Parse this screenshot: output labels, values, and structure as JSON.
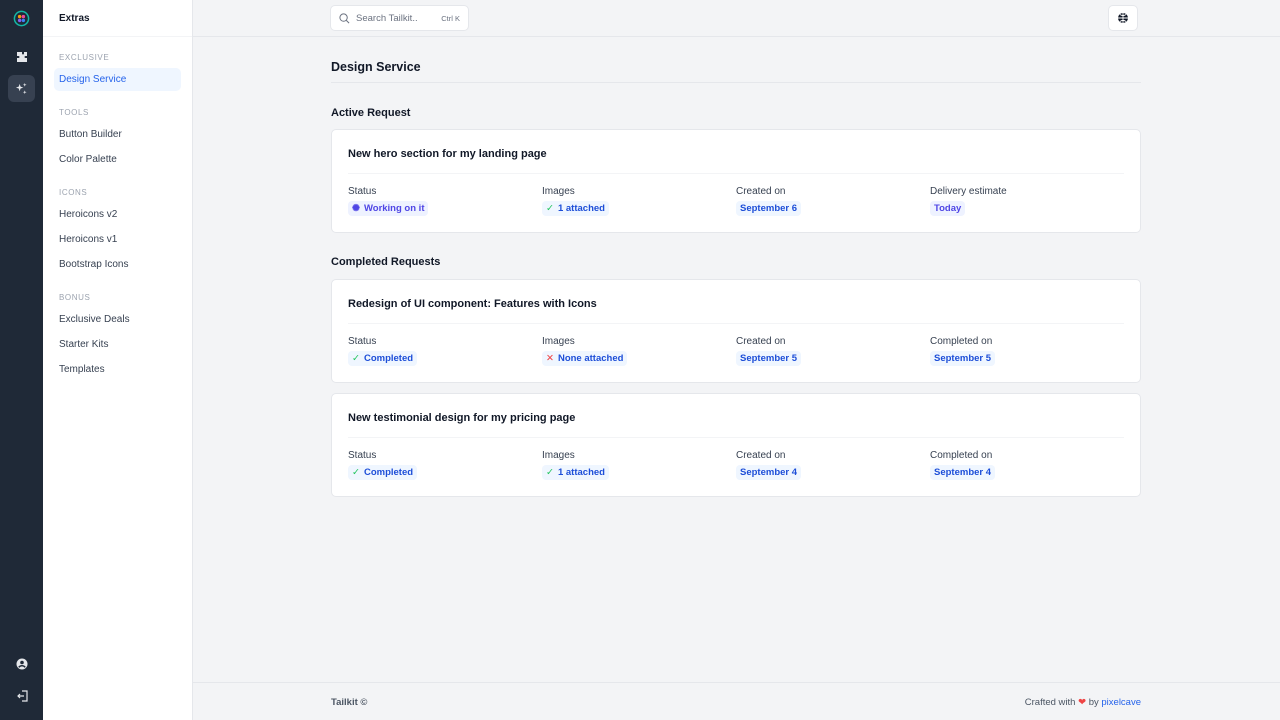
{
  "sidebar": {
    "title": "Extras",
    "groups": [
      {
        "label": "EXCLUSIVE",
        "items": [
          {
            "label": "Design Service",
            "active": true
          }
        ]
      },
      {
        "label": "TOOLS",
        "items": [
          {
            "label": "Button Builder"
          },
          {
            "label": "Color Palette"
          }
        ]
      },
      {
        "label": "ICONS",
        "items": [
          {
            "label": "Heroicons v2"
          },
          {
            "label": "Heroicons v1"
          },
          {
            "label": "Bootstrap Icons"
          }
        ]
      },
      {
        "label": "BONUS",
        "items": [
          {
            "label": "Exclusive Deals"
          },
          {
            "label": "Starter Kits"
          },
          {
            "label": "Templates"
          }
        ]
      }
    ]
  },
  "header": {
    "search_placeholder": "Search Tailkit..",
    "search_shortcut": "Ctrl K"
  },
  "page": {
    "title": "Design Service",
    "active_section": "Active Request",
    "completed_section": "Completed Requests"
  },
  "active_request": {
    "title": "New hero section for my landing page",
    "fields": [
      {
        "label": "Status",
        "value": "Working on it",
        "icon": "sparkle"
      },
      {
        "label": "Images",
        "value": "1 attached",
        "icon": "check"
      },
      {
        "label": "Created on",
        "value": "September 6"
      },
      {
        "label": "Delivery estimate",
        "value": "Today"
      }
    ]
  },
  "completed_requests": [
    {
      "title": "Redesign of UI component: Features with Icons",
      "fields": [
        {
          "label": "Status",
          "value": "Completed",
          "icon": "check"
        },
        {
          "label": "Images",
          "value": "None attached",
          "icon": "x"
        },
        {
          "label": "Created on",
          "value": "September 5"
        },
        {
          "label": "Completed on",
          "value": "September 5"
        }
      ]
    },
    {
      "title": "New testimonial design for my pricing page",
      "fields": [
        {
          "label": "Status",
          "value": "Completed",
          "icon": "check"
        },
        {
          "label": "Images",
          "value": "1 attached",
          "icon": "check"
        },
        {
          "label": "Created on",
          "value": "September 4"
        },
        {
          "label": "Completed on",
          "value": "September 4"
        }
      ]
    }
  ],
  "footer": {
    "left": "Tailkit ©",
    "crafted": "Crafted with",
    "by": "by",
    "link": "pixelcave"
  }
}
